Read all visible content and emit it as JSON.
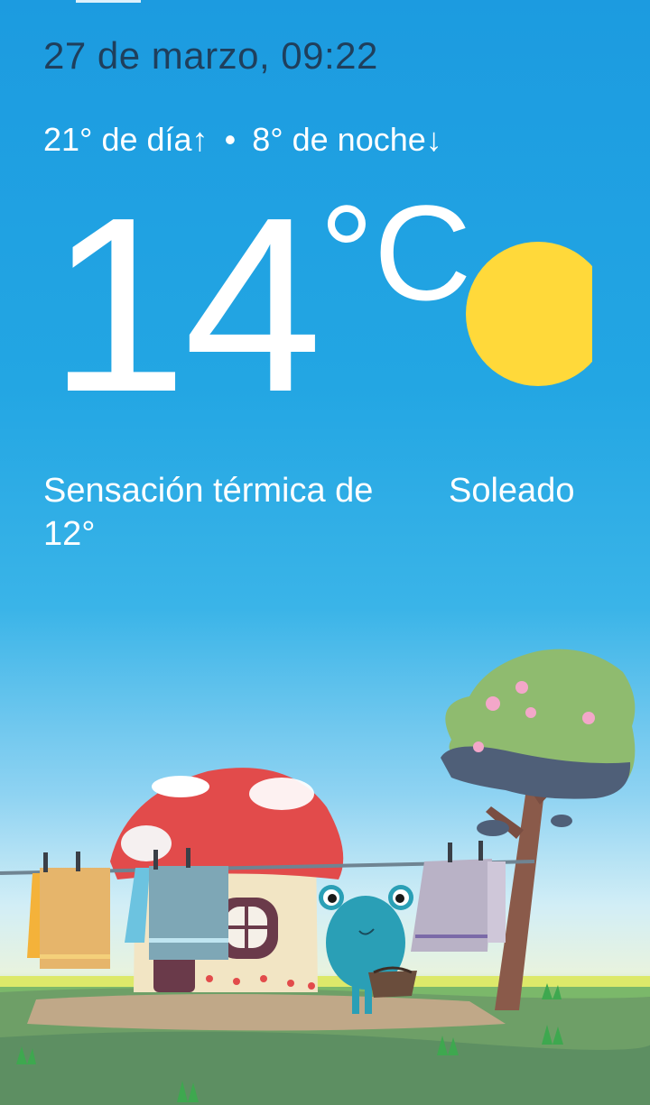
{
  "header": {
    "datetime": "27 de marzo, 09:22"
  },
  "forecast": {
    "day_high": "21°",
    "day_label": "de día↑",
    "separator": "•",
    "night_low": "8°",
    "night_label": "de noche↓"
  },
  "current": {
    "temperature": "14",
    "unit": "°C",
    "feels_like": "Sensación térmica de 12°",
    "condition": "Soleado",
    "condition_icon": "sun-icon"
  },
  "colors": {
    "sky_top": "#1c9be0",
    "sun": "#ffd93a",
    "date_text": "#1f3f5c",
    "text": "#ffffff"
  }
}
